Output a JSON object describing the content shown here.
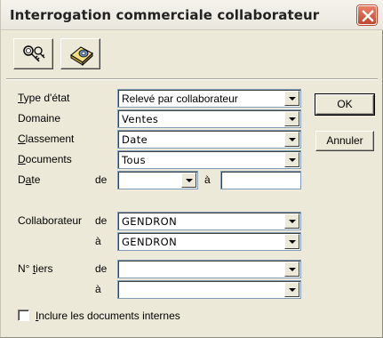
{
  "window": {
    "title": "Interrogation commerciale collaborateur",
    "close_icon": "close-icon"
  },
  "toolbar": {
    "buttons": [
      {
        "icon": "keys-search-icon"
      },
      {
        "icon": "disk-print-icon"
      }
    ]
  },
  "form": {
    "type_etat": {
      "label": "Type d'état",
      "value": "Relevé par collaborateur"
    },
    "domaine": {
      "label": "Domaine",
      "value": "Ventes"
    },
    "classement": {
      "label": "Classement",
      "value": "Date"
    },
    "documents": {
      "label": "Documents",
      "value": "Tous"
    },
    "date": {
      "label": "Date",
      "from_label": "de",
      "to_label": "à",
      "from_value": "",
      "to_value": ""
    },
    "collaborateur": {
      "label": "Collaborateur",
      "from_label": "de",
      "to_label": "à",
      "from_value": "GENDRON",
      "to_value": "GENDRON"
    },
    "tiers": {
      "label": "N° tiers",
      "from_label": "de",
      "to_label": "à",
      "from_value": "",
      "to_value": ""
    },
    "inclure": {
      "label": "Inclure les documents internes",
      "checked": false
    }
  },
  "actions": {
    "ok_label": "OK",
    "cancel_label": "Annuler"
  },
  "colors": {
    "close_button": "#c1462c",
    "field_border": "#7f9db9",
    "dialog_bg": "#ece9d8"
  }
}
